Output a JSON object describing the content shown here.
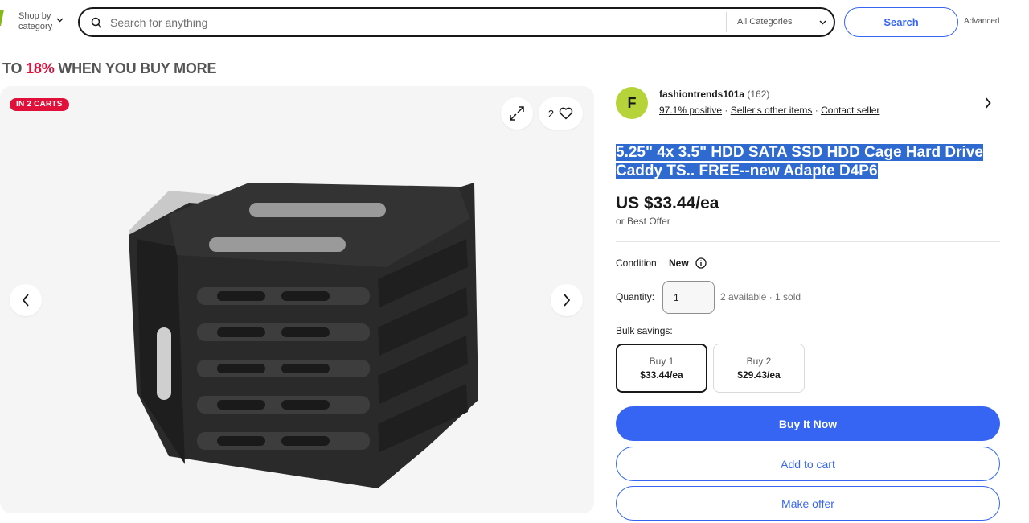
{
  "header": {
    "shop_by_line1": "Shop by",
    "shop_by_line2": "category",
    "search_placeholder": "Search for anything",
    "category_selected": "All Categories",
    "search_button": "Search",
    "advanced_link": "Advanced"
  },
  "promo": {
    "prefix": "TO ",
    "percent": "18%",
    "suffix": " WHEN YOU BUY MORE"
  },
  "gallery": {
    "badge": "IN 2 CARTS",
    "watch_count": "2"
  },
  "seller": {
    "initial": "F",
    "name": "fashiontrends101a",
    "feedback_count": "(162)",
    "positive": "97.1% positive",
    "sep1": " · ",
    "other_items": "Seller's other items",
    "sep2": " · ",
    "contact": "Contact seller"
  },
  "listing": {
    "title": "5.25\" 4x 3.5\" HDD SATA SSD HDD Cage Hard Drive Caddy TS.. FREE--new Adapte D4P6",
    "price": "US $33.44/ea",
    "best_offer": "or Best Offer",
    "condition_label": "Condition:",
    "condition_value": "New",
    "quantity_label": "Quantity:",
    "quantity_value": "1",
    "availability": "2 available · 1 sold",
    "bulk_label": "Bulk savings:",
    "bulk_options": [
      {
        "qty": "Buy 1",
        "price": "$33.44/ea",
        "selected": true
      },
      {
        "qty": "Buy 2",
        "price": "$29.43/ea",
        "selected": false
      }
    ],
    "buy_now": "Buy It Now",
    "add_to_cart": "Add to cart",
    "make_offer": "Make offer"
  },
  "colors": {
    "accent_blue": "#3665f3",
    "promo_red": "#e0103a",
    "avatar_green": "#b6d43a",
    "selection_blue": "#2f6ad1"
  }
}
